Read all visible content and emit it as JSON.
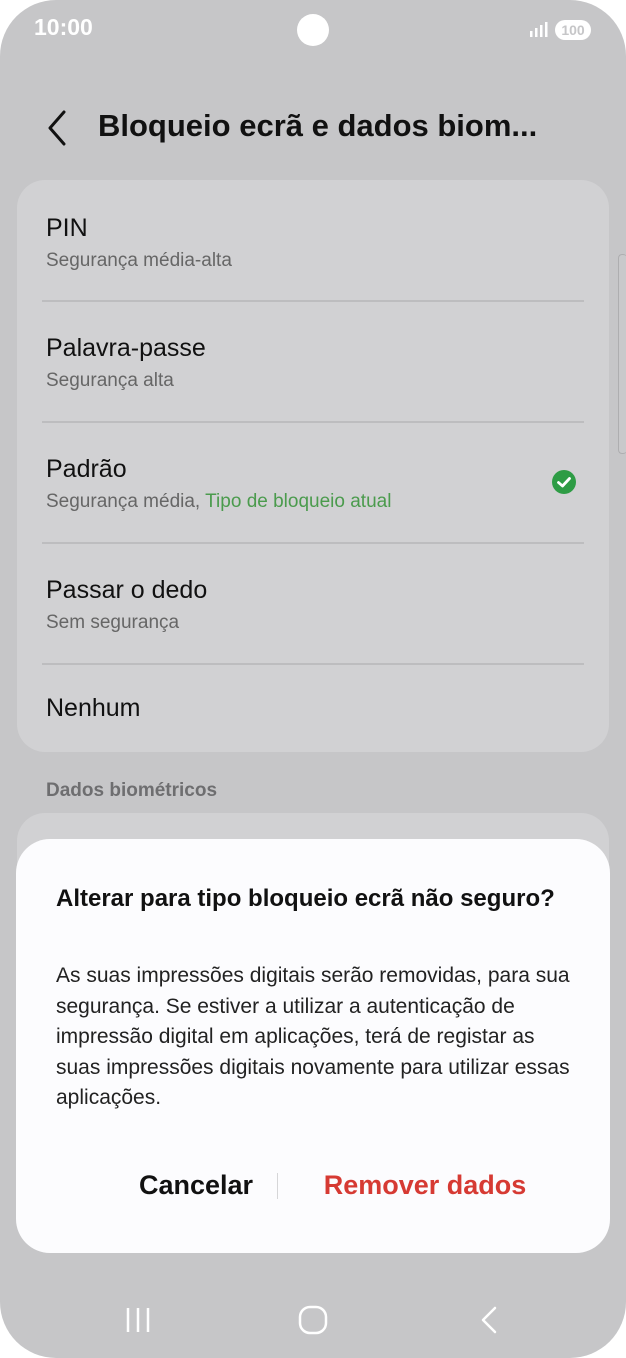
{
  "status_bar": {
    "time": "10:00",
    "battery": "100",
    "icons": [
      "signal-icon",
      "battery-icon"
    ]
  },
  "header": {
    "title": "Bloqueio ecrã e dados biom...",
    "back_icon": "back-chevron-icon"
  },
  "lock_types": [
    {
      "title": "PIN",
      "subtitle": "Segurança média-alta"
    },
    {
      "title": "Palavra-passe",
      "subtitle": "Segurança alta"
    },
    {
      "title": "Padrão",
      "subtitle": "Segurança média, ",
      "current_label": "Tipo de bloqueio atual",
      "selected": true
    },
    {
      "title": "Passar o dedo",
      "subtitle": "Sem segurança"
    },
    {
      "title": "Nenhum",
      "subtitle": ""
    }
  ],
  "section": {
    "biometrics_label": "Dados biométricos"
  },
  "dialog": {
    "title": "Alterar para tipo bloqueio ecrã não seguro?",
    "body": "As suas impressões digitais serão removidas, para sua segurança. Se estiver a utilizar a autenticação de impressão digital em aplicações, terá de registar as suas impressões digitais novamente para utilizar essas aplicações.",
    "cancel_label": "Cancelar",
    "confirm_label": "Remover dados"
  },
  "navigation": [
    "recents-icon",
    "home-icon",
    "back-icon"
  ],
  "colors": {
    "accent_green": "#4b9b4d",
    "destructive_red": "#d63a33",
    "dim_background": "#c6c6c8"
  }
}
